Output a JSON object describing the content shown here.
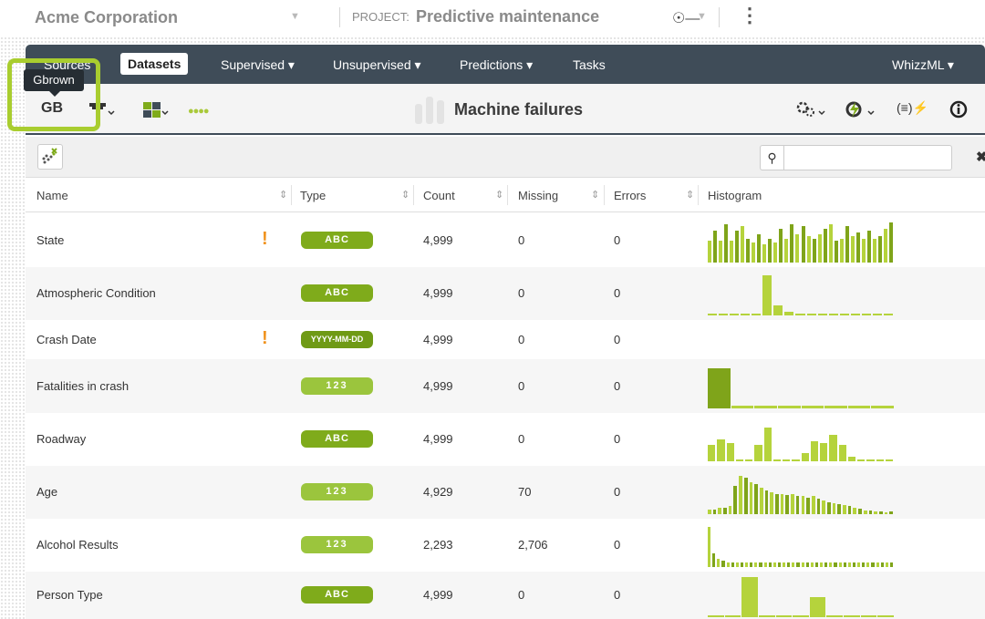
{
  "header": {
    "org": "Acme Corporation",
    "project_label": "PROJECT:",
    "project_name": "Predictive maintenance"
  },
  "nav": {
    "items": [
      "Sources",
      "Datasets",
      "Supervised ▾",
      "Unsupervised ▾",
      "Predictions ▾",
      "Tasks"
    ],
    "right": "WhizzML ▾"
  },
  "toolbar": {
    "owner_initials": "GB",
    "tooltip": "Gbrown",
    "dataset_name": "Machine failures"
  },
  "search": {
    "placeholder": ""
  },
  "columns": [
    "Name",
    "Type",
    "Count",
    "Missing",
    "Errors",
    "Histogram"
  ],
  "colors": {
    "nav": "#3f4c58",
    "accent": "#a9cd2f",
    "text_badge": "#7fab1b",
    "num_badge": "#9bc53d",
    "date_badge": "#6f9a15",
    "warning": "#f0931e",
    "bar": "#b5d33c",
    "bar_dark": "#7fa41a"
  },
  "rows": [
    {
      "name": "State",
      "type": "ABC",
      "kind": "text",
      "warn": true,
      "count": "4,999",
      "missing": "0",
      "errors": "0",
      "hist": [
        0.55,
        0.8,
        0.55,
        0.95,
        0.55,
        0.8,
        0.9,
        0.6,
        0.5,
        0.7,
        0.45,
        0.6,
        0.5,
        0.85,
        0.6,
        0.95,
        0.7,
        0.9,
        0.65,
        0.6,
        0.7,
        0.85,
        0.95,
        0.55,
        0.6,
        0.9,
        0.65,
        0.75,
        0.6,
        0.8,
        0.6,
        0.65,
        0.85,
        1.0
      ]
    },
    {
      "name": "Atmospheric Condition",
      "type": "ABC",
      "kind": "text",
      "warn": false,
      "count": "4,999",
      "missing": "0",
      "errors": "0",
      "hist": [
        0.05,
        0.05,
        0.05,
        0.05,
        0.05,
        1.0,
        0.25,
        0.08,
        0.05,
        0.05,
        0.05,
        0.05,
        0.05,
        0.05,
        0.05,
        0.05,
        0.05
      ]
    },
    {
      "name": "Crash Date",
      "type": "YYYY-MM-DD",
      "kind": "date",
      "warn": true,
      "count": "4,999",
      "missing": "0",
      "errors": "0",
      "hist": []
    },
    {
      "name": "Fatalities in crash",
      "type": "123",
      "kind": "num",
      "warn": false,
      "count": "4,999",
      "missing": "0",
      "errors": "0",
      "hist": [
        1.0,
        0.06,
        0.06,
        0.06,
        0.06,
        0.06,
        0.06,
        0.06
      ]
    },
    {
      "name": "Roadway",
      "type": "ABC",
      "kind": "text",
      "warn": false,
      "count": "4,999",
      "missing": "0",
      "errors": "0",
      "hist": [
        0.4,
        0.55,
        0.45,
        0.05,
        0.05,
        0.4,
        0.85,
        0.05,
        0.05,
        0.05,
        0.2,
        0.5,
        0.45,
        0.65,
        0.4,
        0.12,
        0.05,
        0.05,
        0.05,
        0.05
      ]
    },
    {
      "name": "Age",
      "type": "123",
      "kind": "num",
      "warn": false,
      "count": "4,929",
      "missing": "70",
      "errors": "0",
      "hist": [
        0.12,
        0.12,
        0.15,
        0.15,
        0.2,
        0.7,
        0.95,
        0.9,
        0.8,
        0.75,
        0.65,
        0.6,
        0.55,
        0.5,
        0.5,
        0.48,
        0.5,
        0.45,
        0.45,
        0.42,
        0.45,
        0.38,
        0.35,
        0.3,
        0.28,
        0.25,
        0.22,
        0.2,
        0.15,
        0.14,
        0.1,
        0.08,
        0.07,
        0.06,
        0.05,
        0.06
      ]
    },
    {
      "name": "Alcohol Results",
      "type": "123",
      "kind": "num",
      "warn": false,
      "count": "2,293",
      "missing": "2,706",
      "errors": "0",
      "hist": [
        1.0,
        0.35,
        0.2,
        0.15,
        0.12,
        0.12,
        0.12,
        0.12,
        0.12,
        0.12,
        0.12,
        0.12,
        0.12,
        0.12,
        0.12,
        0.12,
        0.12,
        0.12,
        0.12,
        0.12,
        0.12,
        0.12,
        0.12,
        0.12,
        0.12,
        0.12,
        0.12,
        0.12,
        0.12,
        0.12,
        0.12,
        0.12,
        0.12,
        0.12,
        0.12,
        0.12,
        0.12,
        0.12,
        0.12,
        0.12
      ]
    },
    {
      "name": "Person Type",
      "type": "ABC",
      "kind": "text",
      "warn": false,
      "count": "4,999",
      "missing": "0",
      "errors": "0",
      "hist": [
        0.05,
        0.05,
        1.0,
        0.05,
        0.05,
        0.05,
        0.5,
        0.05,
        0.05,
        0.05,
        0.05
      ]
    }
  ]
}
